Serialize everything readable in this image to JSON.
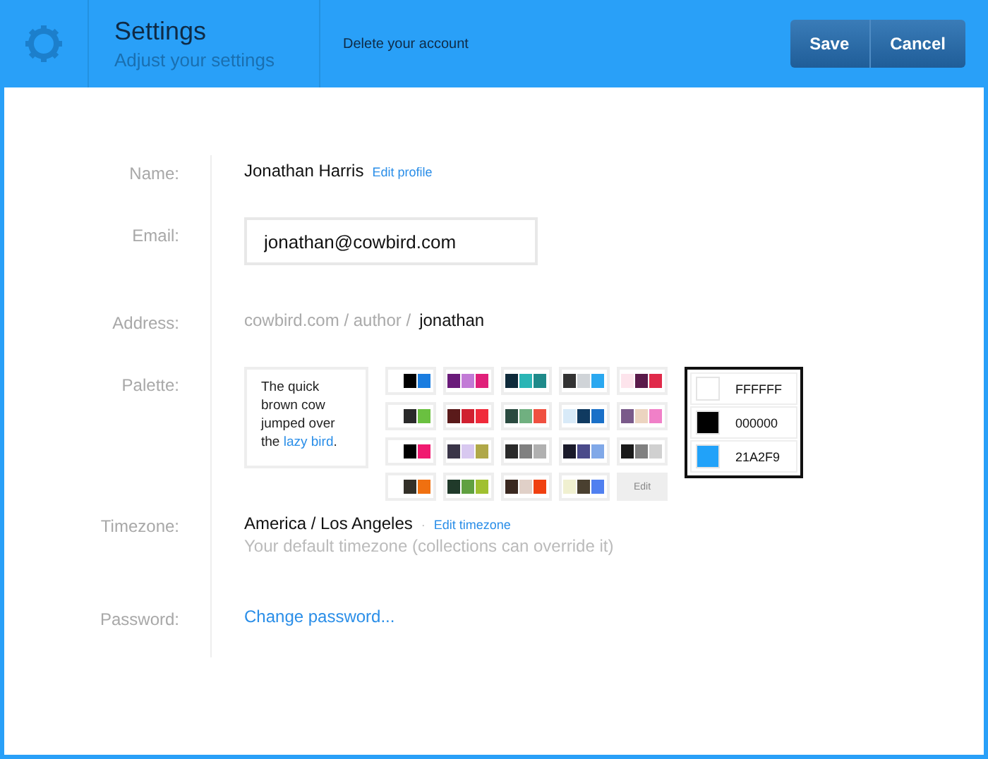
{
  "header": {
    "title": "Settings",
    "subtitle": "Adjust your settings",
    "link": "Delete your account",
    "buttons": [
      "Save",
      "Cancel"
    ]
  },
  "name": {
    "label": "Name:",
    "value": "Jonathan Harris",
    "link": "Edit profile"
  },
  "email": {
    "label": "Email:",
    "value": "jonathan@cowbird.com"
  },
  "address": {
    "label": "Address:",
    "prefix": "cowbird.com / author /",
    "value": "jonathan"
  },
  "palette": {
    "label": "Palette:",
    "preview": "The quick brown cow jumped over the",
    "preview_link": "lazy bird",
    "preview_end": ".",
    "swatches": [
      {
        "chips": [
          {
            "color": "#ffffff"
          },
          {
            "color": "#000000"
          },
          {
            "color": "#1a7de0"
          }
        ]
      },
      {
        "chips": [
          {
            "color": "#6a1b7a"
          },
          {
            "color": "#c27ad6"
          },
          {
            "color": "#e0207a"
          }
        ]
      },
      {
        "chips": [
          {
            "color": "#0e2a3a"
          },
          {
            "color": "#2ab5b5"
          },
          {
            "color": "#1e8a8a"
          }
        ]
      },
      {
        "chips": [
          {
            "color": "#333333"
          },
          {
            "color": "#d0d4d8"
          },
          {
            "color": "#2aa8f0"
          }
        ]
      },
      {
        "chips": [
          {
            "color": "#fde4ec"
          },
          {
            "color": "#5a1a4a"
          },
          {
            "color": "#e02a4a"
          }
        ]
      },
      {
        "chips": [
          {
            "color": "#ffffff"
          },
          {
            "color": "#2a2a2a"
          },
          {
            "color": "#6ac040"
          }
        ]
      },
      {
        "chips": [
          {
            "color": "#5a1a1a"
          },
          {
            "color": "#d02030"
          },
          {
            "color": "#f02a3a"
          }
        ]
      },
      {
        "chips": [
          {
            "color": "#2a4a40"
          },
          {
            "color": "#70b080"
          },
          {
            "color": "#f05040"
          }
        ]
      },
      {
        "chips": [
          {
            "color": "#d8eaf8"
          },
          {
            "color": "#103a60"
          },
          {
            "color": "#1a70c8"
          }
        ]
      },
      {
        "chips": [
          {
            "color": "#7a5a8a"
          },
          {
            "color": "#ecd4c0"
          },
          {
            "color": "#f080c8"
          }
        ]
      },
      {
        "chips": [
          {
            "color": "#ffffff"
          },
          {
            "color": "#000000"
          },
          {
            "color": "#f01a70"
          }
        ]
      },
      {
        "chips": [
          {
            "color": "#3a3548"
          },
          {
            "color": "#d8c8f0"
          },
          {
            "color": "#b0a848"
          }
        ]
      },
      {
        "chips": [
          {
            "color": "#2a2a2a"
          },
          {
            "color": "#808080"
          },
          {
            "color": "#b0b0b0"
          }
        ]
      },
      {
        "chips": [
          {
            "color": "#1a1a2a"
          },
          {
            "color": "#4a4a8a"
          },
          {
            "color": "#80a8e8"
          }
        ]
      },
      {
        "chips": [
          {
            "color": "#1a1a1a"
          },
          {
            "color": "#808080"
          },
          {
            "color": "#d0d0d0"
          }
        ]
      },
      {
        "chips": [
          {
            "color": "#ffffff"
          },
          {
            "color": "#333028"
          },
          {
            "color": "#f07010"
          }
        ]
      },
      {
        "chips": [
          {
            "color": "#203a2a"
          },
          {
            "color": "#60a040"
          },
          {
            "color": "#a0c030"
          }
        ]
      },
      {
        "chips": [
          {
            "color": "#3a2820"
          },
          {
            "color": "#e0d0c8"
          },
          {
            "color": "#f04010"
          }
        ]
      },
      {
        "chips": [
          {
            "color": "#f0f0d0"
          },
          {
            "color": "#4a4030"
          },
          {
            "color": "#5080f0"
          }
        ]
      }
    ],
    "edit": "Edit",
    "current": [
      {
        "hex": "FFFFFF",
        "color": "#ffffff"
      },
      {
        "hex": "000000",
        "color": "#000000"
      },
      {
        "hex": "21A2F9",
        "color": "#21a2f9"
      }
    ]
  },
  "timezone": {
    "label": "Timezone:",
    "value": "America / Los Angeles",
    "separator": "·",
    "link": "Edit timezone",
    "hint": "Your default timezone (collections can override it)"
  },
  "password": {
    "label": "Password:",
    "link": "Change password..."
  }
}
